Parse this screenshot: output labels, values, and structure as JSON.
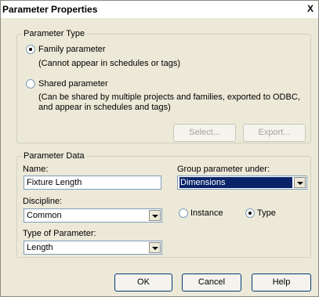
{
  "window": {
    "title": "Parameter Properties",
    "close_glyph": "X"
  },
  "parameter_type": {
    "legend": "Parameter Type",
    "family_label": "Family parameter",
    "family_note": "(Cannot appear in schedules or tags)",
    "shared_label": "Shared parameter",
    "shared_note": "(Can be shared by multiple projects and families, exported to ODBC, and appear in schedules and tags)",
    "select_label": "Select...",
    "export_label": "Export...",
    "selected": "family"
  },
  "parameter_data": {
    "legend": "Parameter Data",
    "name_label": "Name:",
    "name_value": "Fixture Length",
    "discipline_label": "Discipline:",
    "discipline_value": "Common",
    "type_of_param_label": "Type of Parameter:",
    "type_of_param_value": "Length",
    "group_label": "Group parameter under:",
    "group_value": "Dimensions",
    "instance_label": "Instance",
    "type_label": "Type",
    "selected_scope": "type"
  },
  "buttons": {
    "ok": "OK",
    "cancel": "Cancel",
    "help": "Help"
  },
  "colors": {
    "dialog_bg": "#ece9d8",
    "selection": "#0a246a",
    "border": "#7f9db9"
  }
}
